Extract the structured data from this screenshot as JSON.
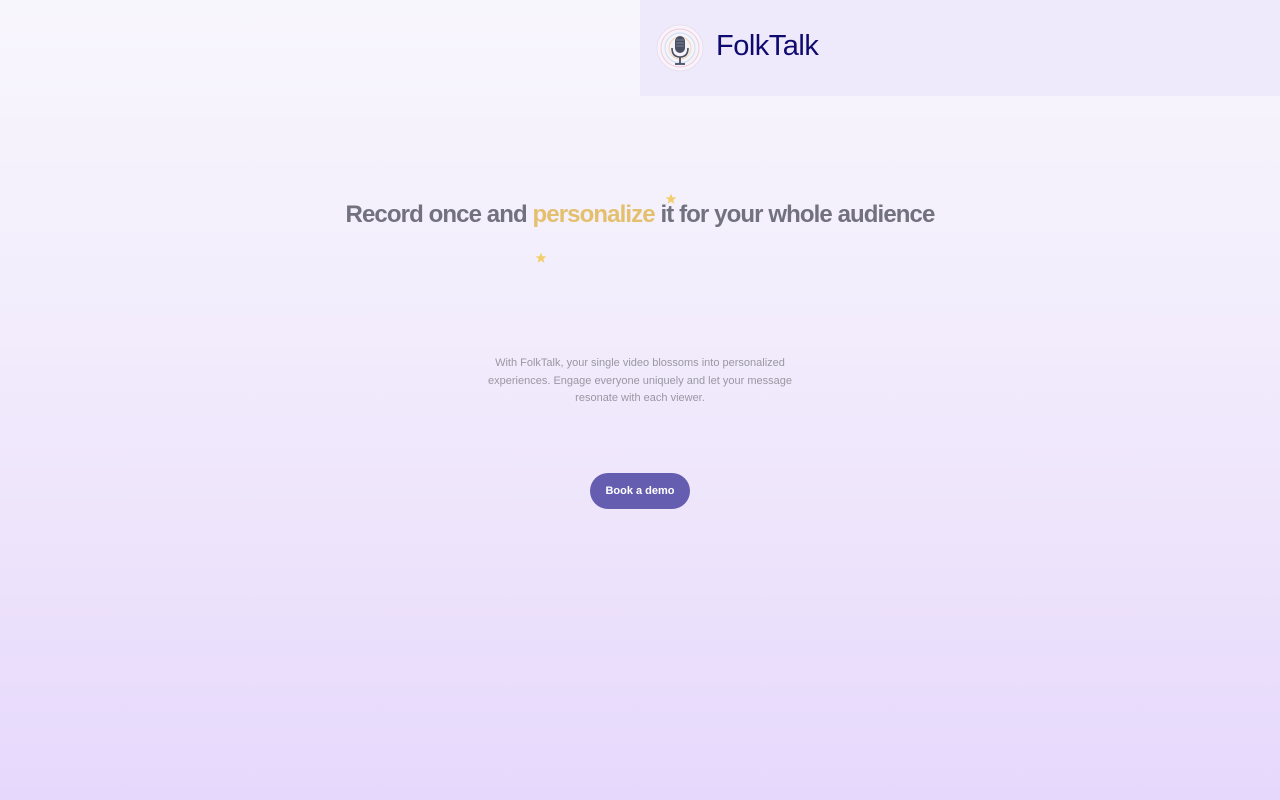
{
  "header": {
    "brand": "FolkTalk",
    "logo_icon": "microphone-icon"
  },
  "hero": {
    "title_before": "Record once and ",
    "title_accent": "personalize",
    "title_after": " it for your whole audience",
    "accent_color": "#e4c06e",
    "sparkle_icon": "sparkle-icon",
    "subtitle": "With FolkTalk, your single video blossoms into personalized experiences. Engage everyone uniquely and let your message resonate with each viewer.",
    "cta_label": "Book a demo",
    "cta_color": "#655eb0"
  },
  "colors": {
    "brand_text": "#0f0a6e",
    "title_text": "#72717e",
    "header_bg": "#efeafb"
  }
}
